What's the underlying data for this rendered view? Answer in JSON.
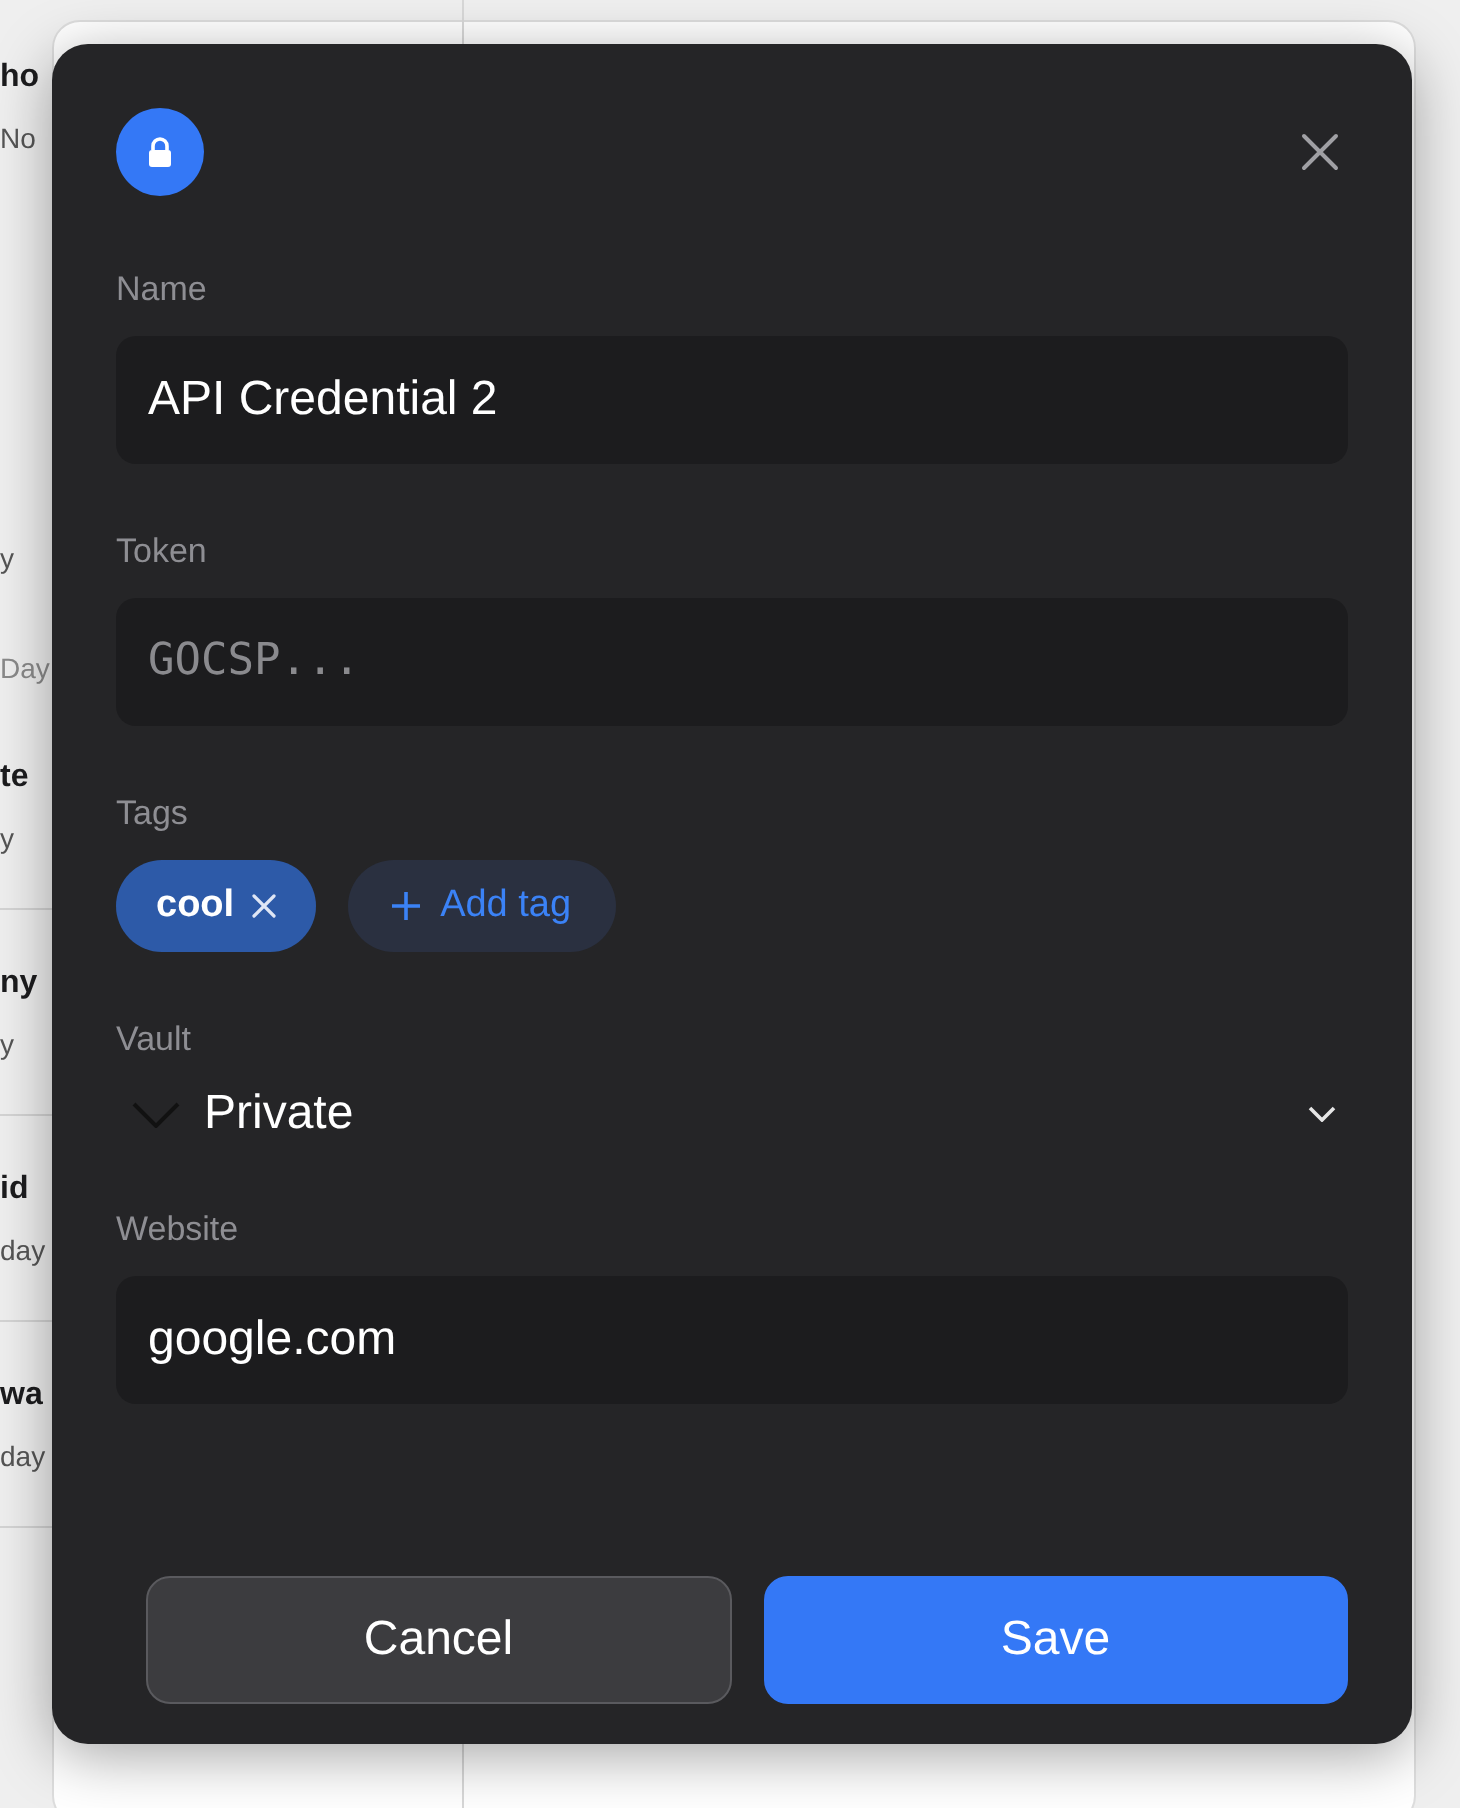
{
  "background_list": [
    {
      "kind": "title",
      "text": "ho"
    },
    {
      "kind": "subtitle",
      "text": "No"
    },
    {
      "kind": "gap"
    },
    {
      "kind": "subtitle",
      "text": "y"
    },
    {
      "kind": "section",
      "text": "Day"
    },
    {
      "kind": "title",
      "text": "te"
    },
    {
      "kind": "subtitle",
      "text": "y"
    },
    {
      "kind": "divider"
    },
    {
      "kind": "title",
      "text": "ny"
    },
    {
      "kind": "subtitle",
      "text": "y"
    },
    {
      "kind": "divider"
    },
    {
      "kind": "title",
      "text": "id"
    },
    {
      "kind": "subtitle",
      "text": "day"
    },
    {
      "kind": "divider"
    },
    {
      "kind": "title",
      "text": "wa"
    },
    {
      "kind": "subtitle",
      "text": "day"
    },
    {
      "kind": "divider"
    }
  ],
  "dialog": {
    "fields": [
      {
        "kind": "text",
        "label": "Name",
        "value": "API Credential 2"
      },
      {
        "kind": "secret",
        "label": "Token",
        "placeholder": "GOCSP..."
      },
      {
        "kind": "tags",
        "label": "Tags",
        "tags": [
          "cool"
        ],
        "add_label": "Add tag"
      },
      {
        "kind": "select",
        "label": "Vault",
        "value": "Private"
      },
      {
        "kind": "text",
        "label": "Website",
        "value": "google.com"
      }
    ],
    "buttons": [
      {
        "label": "Cancel",
        "primary": false
      },
      {
        "label": "Save",
        "primary": true
      }
    ]
  }
}
